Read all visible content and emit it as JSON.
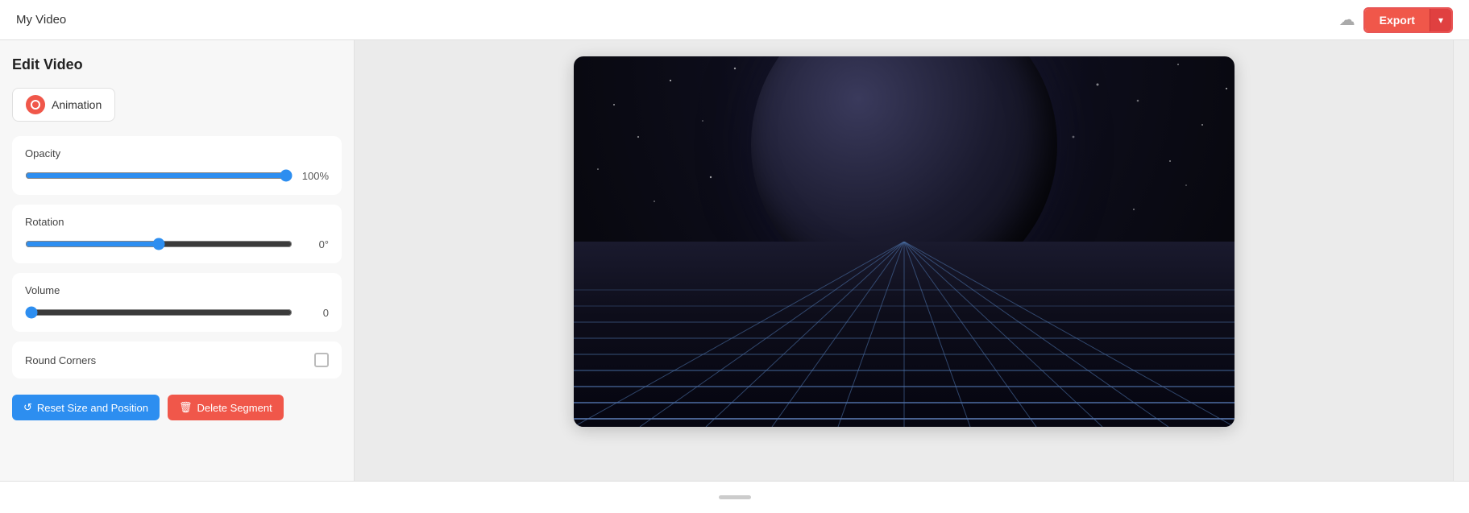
{
  "header": {
    "title": "My Video",
    "export_label": "Export",
    "export_dropdown_icon": "▾"
  },
  "sidebar": {
    "page_title": "Edit Video",
    "animation_label": "Animation",
    "opacity": {
      "label": "Opacity",
      "value": 100,
      "display": "100%",
      "percent": 100
    },
    "rotation": {
      "label": "Rotation",
      "value": 0,
      "display": "0°",
      "percent": 50
    },
    "volume": {
      "label": "Volume",
      "value": 0,
      "display": "0",
      "percent": 2
    },
    "round_corners": {
      "label": "Round Corners",
      "checked": false
    },
    "reset_btn": "Reset Size and Position",
    "delete_btn": "Delete Segment"
  }
}
